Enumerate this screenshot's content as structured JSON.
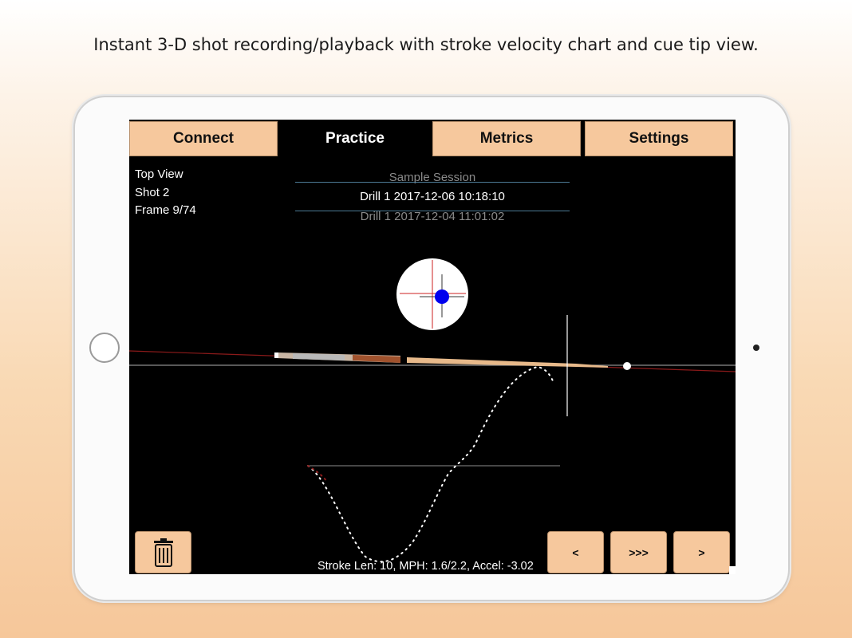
{
  "caption": "Instant 3-D shot recording/playback with stroke velocity chart and cue tip view.",
  "tabs": [
    {
      "label": "Connect",
      "active": false
    },
    {
      "label": "Practice",
      "active": true
    },
    {
      "label": "Metrics",
      "active": false
    },
    {
      "label": "Settings",
      "active": false
    }
  ],
  "info": {
    "view": "Top View",
    "shot": "Shot 2",
    "frame": "Frame 9/74"
  },
  "session_picker": {
    "previous": "Sample Session",
    "selected": "Drill 1 2017-12-06 10:18:10",
    "next": "Drill 1 2017-12-04 11:01:02"
  },
  "stroke_stats": "Stroke Len: 10, MPH: 1.6/2.2, Accel: -3.02",
  "controls": {
    "delete_icon": "trash-icon",
    "prev_label": "<",
    "play_label": ">>>",
    "next_label": ">"
  },
  "colors": {
    "tab_fill": "#f6c89d",
    "screen_bg": "#000000",
    "tip_marker": "#0000ee",
    "crosshair_red": "#cc2222",
    "cue_trail": "#8b1a1a"
  }
}
